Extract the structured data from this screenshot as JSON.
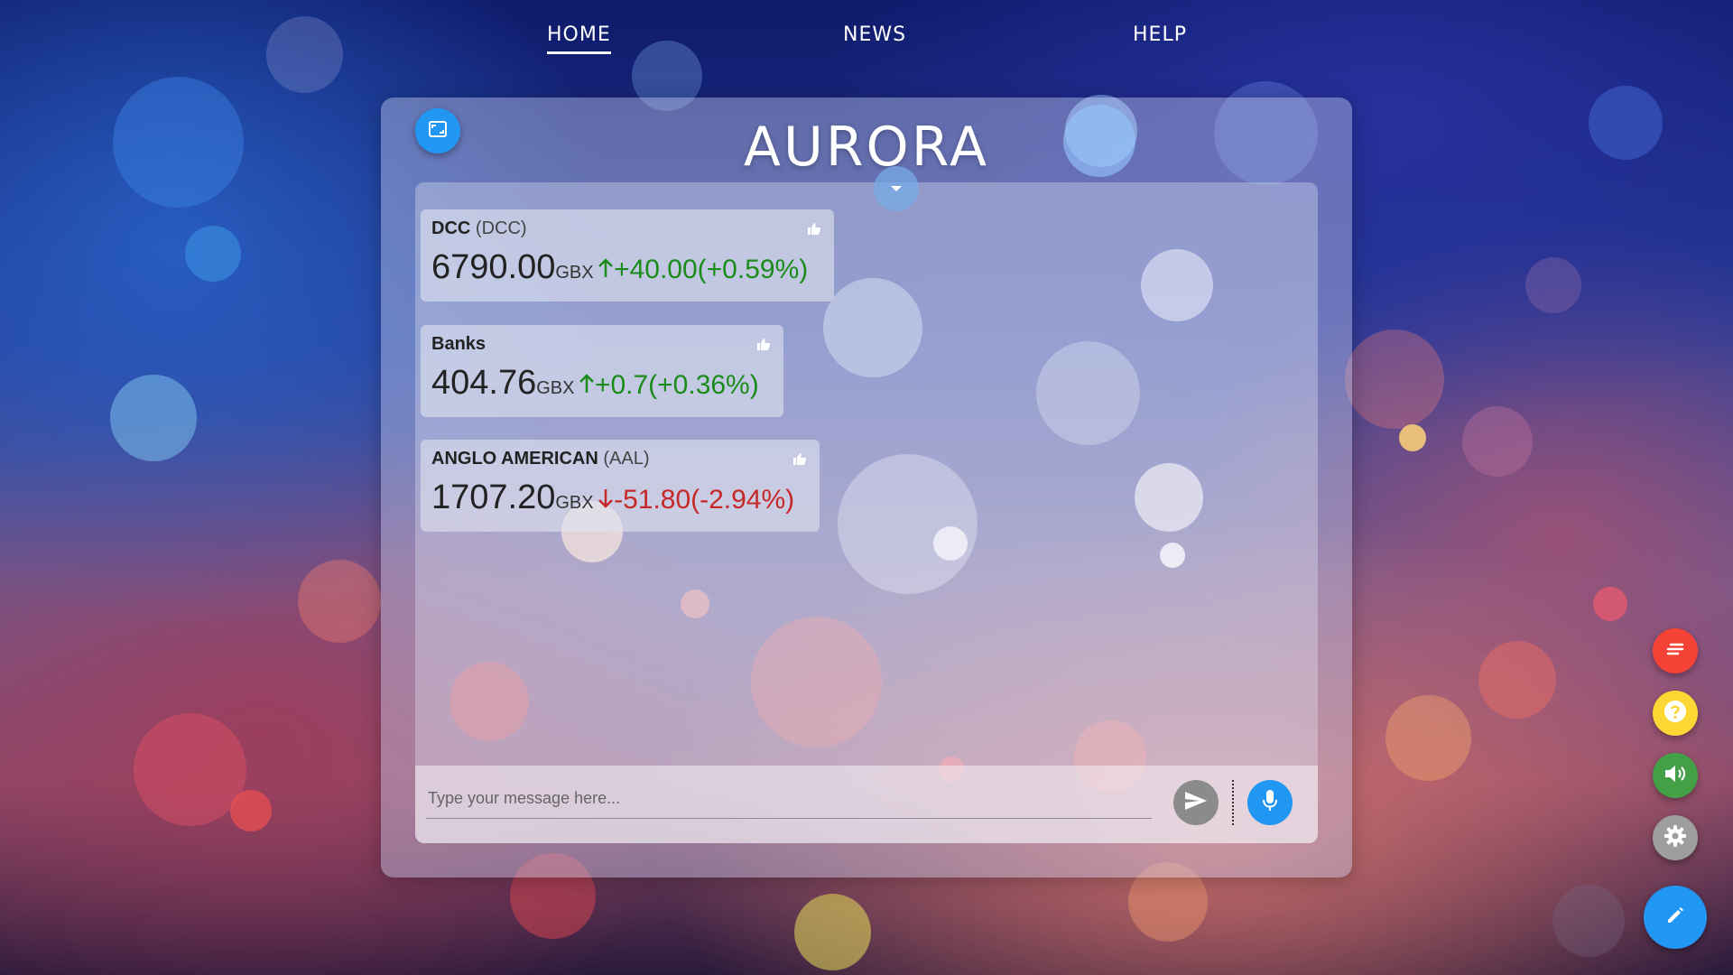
{
  "nav": {
    "home": "HOME",
    "news": "NEWS",
    "help": "HELP"
  },
  "app": {
    "title": "AURORA"
  },
  "stocks": [
    {
      "name": "DCC",
      "ticker": "(DCC)",
      "price": "6790.00",
      "currency": "GBX",
      "direction": "up",
      "change": "+40.00(+0.59%)"
    },
    {
      "name": "Banks",
      "ticker": "",
      "price": "404.76",
      "currency": "GBX",
      "direction": "up",
      "change": "+0.7(+0.36%)"
    },
    {
      "name": "ANGLO AMERICAN",
      "ticker": "(AAL)",
      "price": "1707.20",
      "currency": "GBX",
      "direction": "down",
      "change": "-51.80(-2.94%)"
    }
  ],
  "chat": {
    "placeholder": "Type your message here..."
  },
  "colors": {
    "accent": "#2196f3",
    "up": "#1a8c1a",
    "down": "#c62828",
    "fab_red": "#f44336",
    "fab_yellow": "#fdd835",
    "fab_green": "#43a047",
    "fab_grey": "#9e9e9e"
  },
  "icons": [
    "expand-icon",
    "chevron-down-icon",
    "thumbs-up-icon",
    "arrow-up-icon",
    "arrow-down-icon",
    "send-icon",
    "microphone-icon",
    "subtitles-icon",
    "help-icon",
    "volume-icon",
    "gear-icon",
    "pencil-icon"
  ]
}
